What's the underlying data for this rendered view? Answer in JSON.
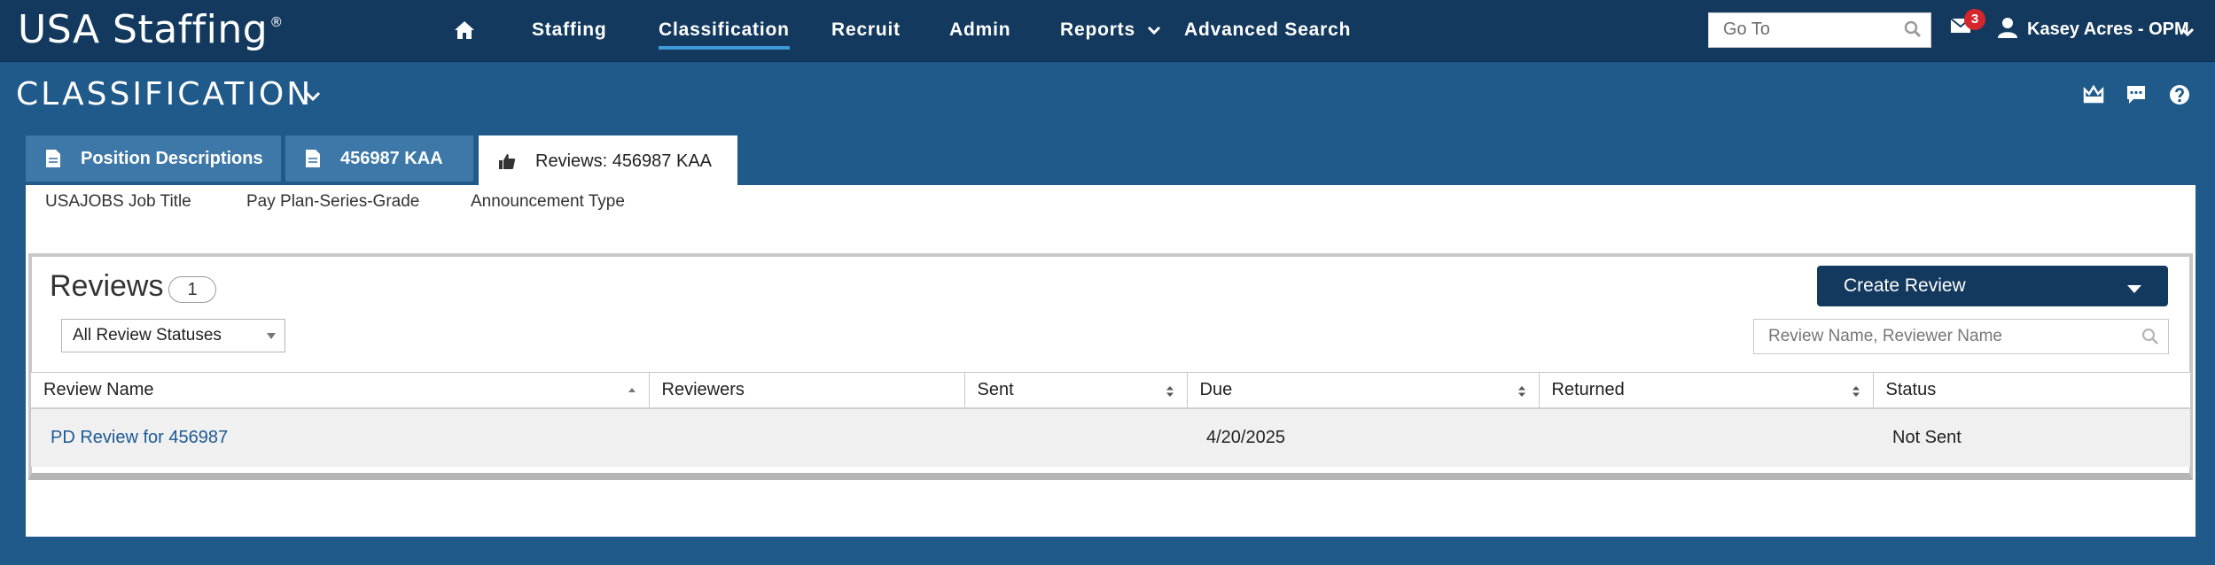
{
  "brand": {
    "name": "USA Staffing",
    "mark": "®"
  },
  "nav": {
    "items": [
      {
        "label": "Staffing"
      },
      {
        "label": "Classification",
        "active": true
      },
      {
        "label": "Recruit"
      },
      {
        "label": "Admin"
      },
      {
        "label": "Reports"
      },
      {
        "label": "Advanced Search"
      }
    ],
    "goto_placeholder": "Go To",
    "mail_count": "3",
    "user_name": "Kasey Acres - OPM"
  },
  "app": {
    "title": "CLASSIFICATION"
  },
  "tabs": [
    {
      "label": "Position Descriptions",
      "icon": "document-icon"
    },
    {
      "label": "456987 KAA",
      "icon": "document-icon"
    },
    {
      "label": "Reviews: 456987 KAA",
      "icon": "thumbs-up-icon",
      "active": true
    }
  ],
  "fields": [
    "USAJOBS Job Title",
    "Pay Plan-Series-Grade",
    "Announcement Type"
  ],
  "reviews": {
    "title": "Reviews",
    "count": "1",
    "status_filter": "All Review Statuses",
    "create_label": "Create Review",
    "search_placeholder": "Review Name, Reviewer Name",
    "columns": [
      "Review Name",
      "Reviewers",
      "Sent",
      "Due",
      "Returned",
      "Status"
    ],
    "rows": [
      {
        "name": "PD Review for 456987",
        "reviewers": "",
        "sent": "",
        "due": "4/20/2025",
        "returned": "",
        "status": "Not Sent"
      }
    ]
  },
  "colors": {
    "navbar": "#13395e",
    "background": "#1f5a8a",
    "tab": "#3e78a8",
    "accent": "#3f9ad8",
    "badge": "#d4262c",
    "link": "#1d5a96"
  }
}
